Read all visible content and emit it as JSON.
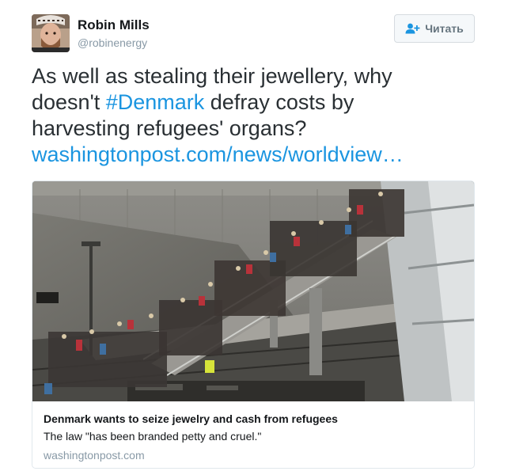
{
  "author": {
    "name": "Robin Mills",
    "handle": "@robinenergy"
  },
  "follow_button": {
    "label": "Читать",
    "icon": "follow-person-plus-icon"
  },
  "tweet": {
    "line1": "As well as stealing their jewellery, why",
    "line2_before": "doesn't ",
    "hashtag": "#Denmark",
    "line2_after": " defray costs by",
    "line3": "harvesting refugees' organs?",
    "link": "washingtonpost.com/news/worldview…"
  },
  "card": {
    "image_subject": "crowd of refugees on railway station stairs",
    "title": "Denmark wants to seize jewelry and cash from refugees",
    "description": "The law \"has been branded petty and cruel.\"",
    "domain": "washingtonpost.com"
  },
  "colors": {
    "link": "#1b95e0",
    "text": "#292f33",
    "muted": "#8899a6"
  }
}
